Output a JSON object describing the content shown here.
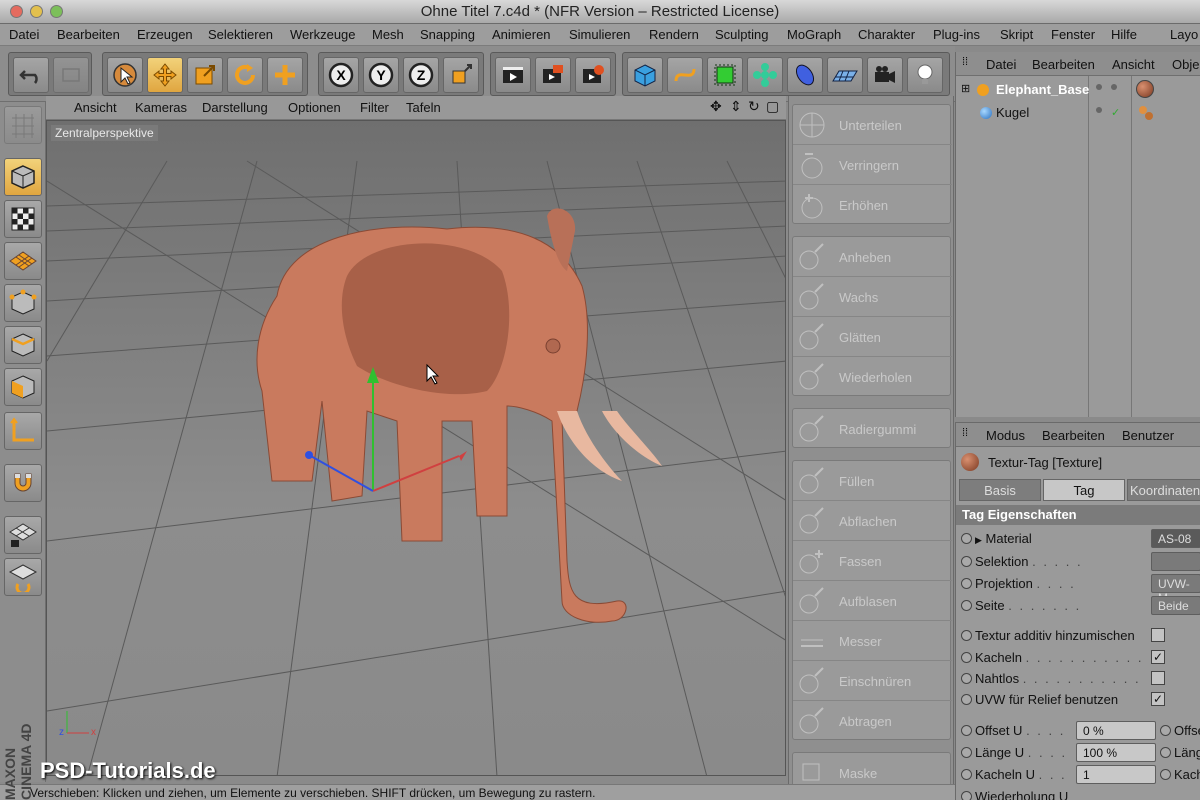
{
  "window": {
    "title": "Ohne Titel 7.c4d * (NFR Version – Restricted License)"
  },
  "menu": [
    "Datei",
    "Bearbeiten",
    "Erzeugen",
    "Selektieren",
    "Werkzeuge",
    "Mesh",
    "Snapping",
    "Animieren",
    "Simulieren",
    "Rendern",
    "Sculpting",
    "MoGraph",
    "Charakter",
    "Plug-ins",
    "Skript",
    "Fenster",
    "Hilfe",
    "Layo"
  ],
  "toolbar_icons": [
    "undo-icon",
    "redo-icon",
    "live-select-icon",
    "move-icon",
    "scale-icon",
    "rotate-icon",
    "recent-tool-icon",
    "x-axis-icon",
    "y-axis-icon",
    "z-axis-icon",
    "coordinate-system-icon",
    "render-view-icon",
    "render-picture-viewer-icon",
    "render-settings-icon",
    "cube-icon",
    "spline-icon",
    "subdivision-icon",
    "mograph-cloner-icon",
    "deformer-icon",
    "floor-icon",
    "camera-icon",
    "light-icon"
  ],
  "viewport": {
    "menu": [
      "Ansicht",
      "Kameras",
      "Darstellung",
      "Optionen",
      "Filter",
      "Tafeln"
    ],
    "label": "Zentralperspektive"
  },
  "sculpt_tools": [
    "Unterteilen",
    "Verringern",
    "Erhöhen",
    "Anheben",
    "Wachs",
    "Glätten",
    "Wiederholen",
    "Radiergummi",
    "Füllen",
    "Abflachen",
    "Fassen",
    "Aufblasen",
    "Messer",
    "Einschnüren",
    "Abtragen",
    "Maske"
  ],
  "objects": {
    "menu": [
      "Datei",
      "Bearbeiten",
      "Ansicht",
      "Obje"
    ],
    "items": [
      {
        "name": "Elephant_Base"
      },
      {
        "name": "Kugel"
      }
    ]
  },
  "attributes": {
    "menu": [
      "Modus",
      "Bearbeiten",
      "Benutzer"
    ],
    "tag_title": "Textur-Tag [Texture]",
    "tabs": [
      "Basis",
      "Tag",
      "Koordinaten"
    ],
    "active_tab": "Tag",
    "section": "Tag Eigenschaften",
    "material_label": "Material",
    "material_value": "AS-08",
    "selektion_label": "Selektion",
    "selektion_value": "",
    "projektion_label": "Projektion",
    "projektion_value": "UVW-M",
    "seite_label": "Seite",
    "seite_value": "Beide",
    "texture_additive_label": "Textur additiv hinzumischen",
    "kacheln_label": "Kacheln",
    "nahtlos_label": "Nahtlos",
    "uvw_relief_label": "UVW für Relief benutzen",
    "offset_u_label": "Offset U",
    "offset_u_value": "0 %",
    "offset_v_label": "Offse",
    "laenge_u_label": "Länge U",
    "laenge_u_value": "100 %",
    "laenge_v_label": "Läng",
    "kacheln_u_label": "Kacheln U",
    "kacheln_u_value": "1",
    "kacheln_v_label": "Kach",
    "wiederholung_u_label": "Wiederholung U"
  },
  "status": "Verschieben: Klicken und ziehen, um Elemente zu verschieben. SHIFT drücken, um Bewegung zu rastern.",
  "watermark": "PSD-Tutorials.de",
  "brand": "MAXON CINEMA 4D",
  "colors": {
    "elephant": "#c97a5e",
    "accent_x": "#d04040",
    "accent_y": "#30c030",
    "accent_z": "#3050e0"
  }
}
